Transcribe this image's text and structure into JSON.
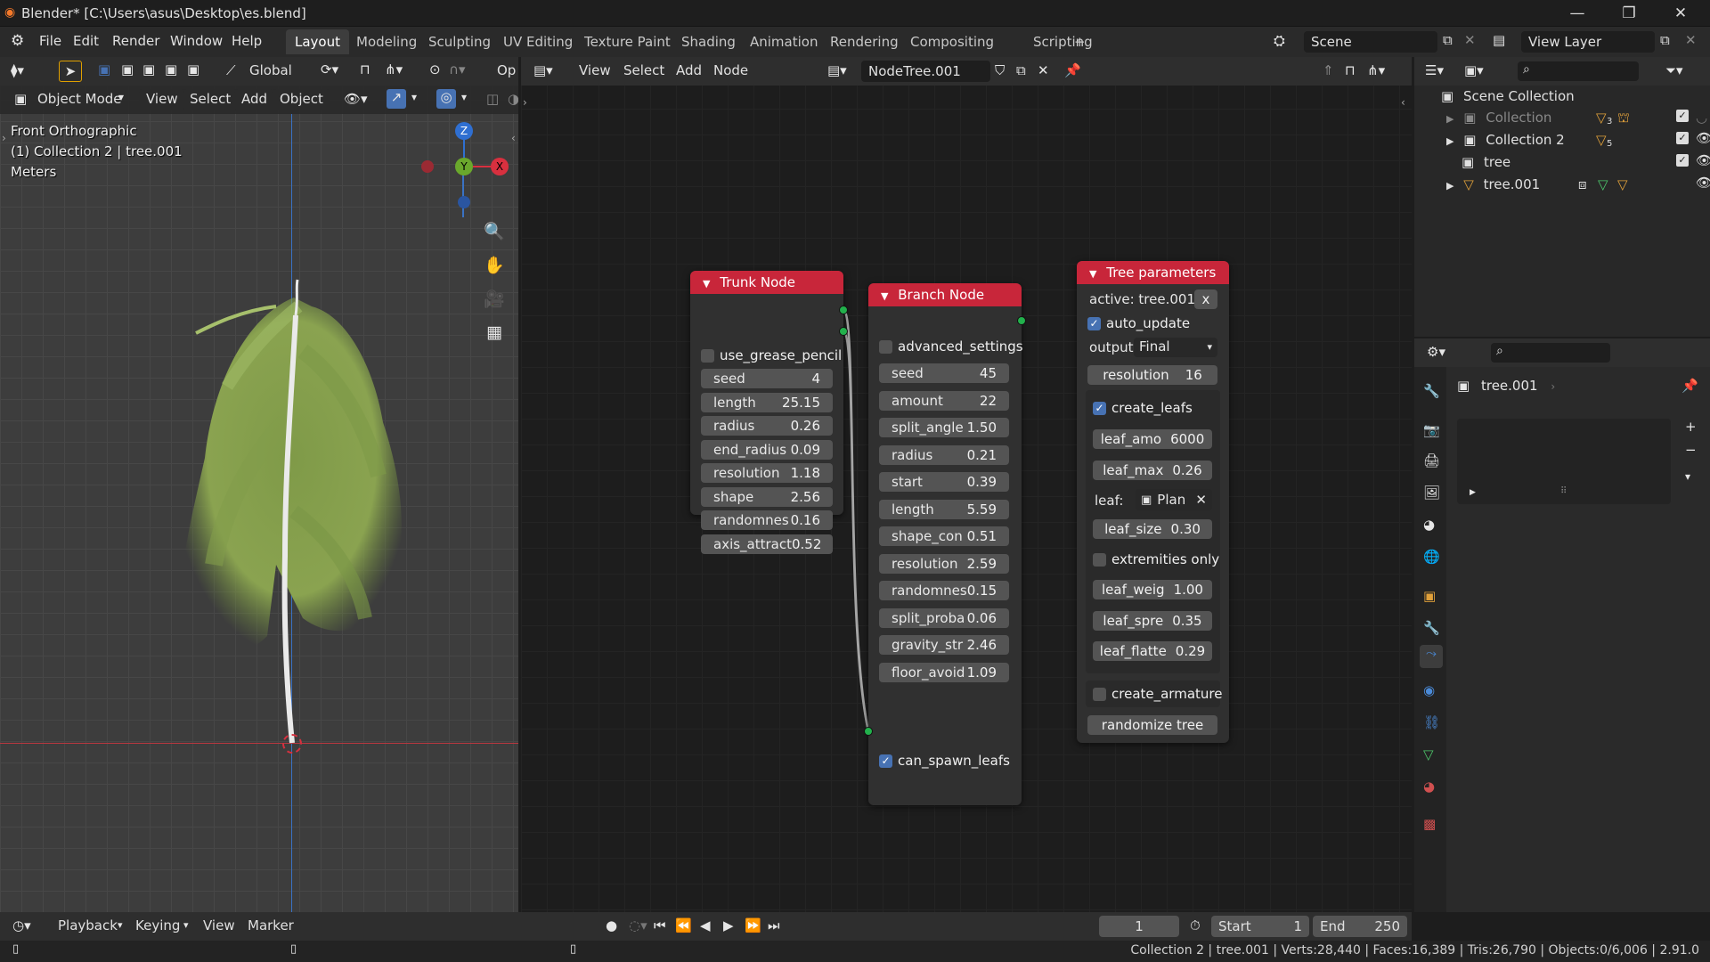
{
  "titlebar": {
    "title": "Blender* [C:\\Users\\asus\\Desktop\\es.blend]"
  },
  "menubar": {
    "menus": [
      "File",
      "Edit",
      "Render",
      "Window",
      "Help"
    ],
    "workspaces": [
      "Layout",
      "Modeling",
      "Sculpting",
      "UV Editing",
      "Texture Paint",
      "Shading",
      "Animation",
      "Rendering",
      "Compositing",
      "Scripting"
    ],
    "active_workspace": "Layout",
    "add_tab": "+",
    "scene": "Scene",
    "view_layer": "View Layer"
  },
  "viewport": {
    "transform": "Global",
    "mode": "Object Mode",
    "menus": [
      "View",
      "Select",
      "Add",
      "Object"
    ],
    "view_name": "Front Orthographic",
    "collection_info": "(1) Collection 2 | tree.001",
    "units": "Meters",
    "gizmo": {
      "z": "Z",
      "y": "Y",
      "x": "X"
    }
  },
  "node_editor": {
    "menus": [
      "View",
      "Select",
      "Add",
      "Node"
    ],
    "tree_name": "NodeTree.001",
    "trunk": {
      "title": "Trunk Node",
      "checkbox": "use_grease_pencil",
      "props": [
        {
          "label": "seed",
          "value": "4"
        },
        {
          "label": "length",
          "value": "25.15"
        },
        {
          "label": "radius",
          "value": "0.26"
        },
        {
          "label": "end_radius",
          "value": "0.09"
        },
        {
          "label": "resolution",
          "value": "1.18"
        },
        {
          "label": "shape",
          "value": "2.56"
        },
        {
          "label": "randomnes",
          "value": "0.16"
        },
        {
          "label": "axis_attract",
          "value": "0.52"
        }
      ]
    },
    "branch": {
      "title": "Branch Node",
      "checkbox": "advanced_settings",
      "props": [
        {
          "label": "seed",
          "value": "45"
        },
        {
          "label": "amount",
          "value": "22"
        },
        {
          "label": "split_angle",
          "value": "1.50"
        },
        {
          "label": "radius",
          "value": "0.21"
        },
        {
          "label": "start",
          "value": "0.39"
        },
        {
          "label": "length",
          "value": "5.59"
        },
        {
          "label": "shape_con",
          "value": "0.51"
        },
        {
          "label": "resolution",
          "value": "2.59"
        },
        {
          "label": "randomnes",
          "value": "0.15"
        },
        {
          "label": "split_proba",
          "value": "0.06"
        },
        {
          "label": "gravity_str",
          "value": "2.46"
        },
        {
          "label": "floor_avoid",
          "value": "1.09"
        }
      ],
      "checkbox2": "can_spawn_leafs"
    },
    "tree": {
      "title": "Tree parameters",
      "active": "active: tree.001",
      "clear": "x",
      "auto_update": "auto_update",
      "output_label": "output:",
      "output_value": "Final",
      "resolution": {
        "label": "resolution",
        "value": "16"
      },
      "create_leafs": "create_leafs",
      "leaf_props1": [
        {
          "label": "leaf_amo",
          "value": "6000"
        },
        {
          "label": "leaf_max",
          "value": "0.26"
        }
      ],
      "leaf_label": "leaf:",
      "leaf_value": "Plan",
      "leaf_size": {
        "label": "leaf_size",
        "value": "0.30"
      },
      "extremities": "extremities only",
      "leaf_props2": [
        {
          "label": "leaf_weig",
          "value": "1.00"
        },
        {
          "label": "leaf_spre",
          "value": "0.35"
        },
        {
          "label": "leaf_flatte",
          "value": "0.29"
        }
      ],
      "create_armature": "create_armature",
      "randomize": "randomize tree"
    }
  },
  "outliner": {
    "root": "Scene Collection",
    "items": [
      {
        "name": "Collection",
        "badge": "3"
      },
      {
        "name": "Collection 2",
        "badge": "5"
      },
      {
        "name": "tree",
        "badge": ""
      },
      {
        "name": "tree.001",
        "badge": ""
      }
    ]
  },
  "properties": {
    "object": "tree.001"
  },
  "timeline": {
    "menus": [
      "Playback",
      "Keying",
      "View",
      "Marker"
    ],
    "frame": "1",
    "start_label": "Start",
    "start": "1",
    "end_label": "End",
    "end": "250"
  },
  "statusbar": {
    "info": "Collection 2 | tree.001 | Verts:28,440 | Faces:16,389 | Tris:26,790 | Objects:0/6,006 | 2.91.0"
  }
}
